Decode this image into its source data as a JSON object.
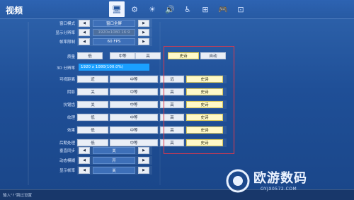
{
  "app": {
    "title": "视频"
  },
  "nav_icons": [
    {
      "name": "monitor-icon",
      "glyph": "🖥",
      "active": true
    },
    {
      "name": "gear-icon",
      "glyph": "⚙",
      "active": false
    },
    {
      "name": "brightness-icon",
      "glyph": "☀",
      "active": false
    },
    {
      "name": "speaker-icon",
      "glyph": "🔊",
      "active": false
    },
    {
      "name": "accessibility-icon",
      "glyph": "♿",
      "active": false
    },
    {
      "name": "network-icon",
      "glyph": "⊞",
      "active": false
    },
    {
      "name": "gamepad-icon",
      "glyph": "🎮",
      "active": false
    },
    {
      "name": "controller-icon",
      "glyph": "⊡",
      "active": false
    }
  ],
  "settings": {
    "window_mode": {
      "label": "窗口模式",
      "value": "窗口全屏"
    },
    "display_resolution": {
      "label": "显示分辨率",
      "value": "1920x1080 16:9"
    },
    "frame_rate_limit": {
      "label": "帧率限制",
      "value": "60 FPS"
    },
    "quality": {
      "label": "质量",
      "options": [
        "低",
        "中等",
        "高",
        "史诗",
        "自动"
      ],
      "selected": "史诗"
    },
    "resolution_3d": {
      "label": "3D 分辨率",
      "value": "1920 x 1080(100.0%)",
      "fill": 1.0
    },
    "quality_rows": [
      {
        "label": "可视距离",
        "options": [
          "近",
          "中等",
          "远",
          "史诗"
        ],
        "selected": "史诗"
      },
      {
        "label": "阴影",
        "options": [
          "关",
          "中等",
          "高",
          "史诗"
        ],
        "selected": "史诗"
      },
      {
        "label": "抗锯齿",
        "options": [
          "关",
          "中等",
          "高",
          "史诗"
        ],
        "selected": "史诗"
      },
      {
        "label": "纹理",
        "options": [
          "低",
          "中等",
          "高",
          "史诗"
        ],
        "selected": "史诗"
      },
      {
        "label": "效果",
        "options": [
          "低",
          "中等",
          "高",
          "史诗"
        ],
        "selected": "史诗"
      },
      {
        "label": "后期处理",
        "options": [
          "低",
          "中等",
          "高",
          "史诗"
        ],
        "selected": "史诗"
      }
    ],
    "vsync": {
      "label": "垂直同步",
      "value": "关"
    },
    "motion_blur": {
      "label": "动态模糊",
      "value": "开"
    },
    "show_fps": {
      "label": "显示帧率",
      "value": "关"
    }
  },
  "statusbar": {
    "text": "输入\"?\"跳过设置"
  },
  "watermark": {
    "main": "欧游数码",
    "sub": "OYJX0572.COM"
  },
  "colors": {
    "accent": "#1aa0ff",
    "selected": "#fff9c8",
    "highlight_frame": "#e0384a"
  }
}
